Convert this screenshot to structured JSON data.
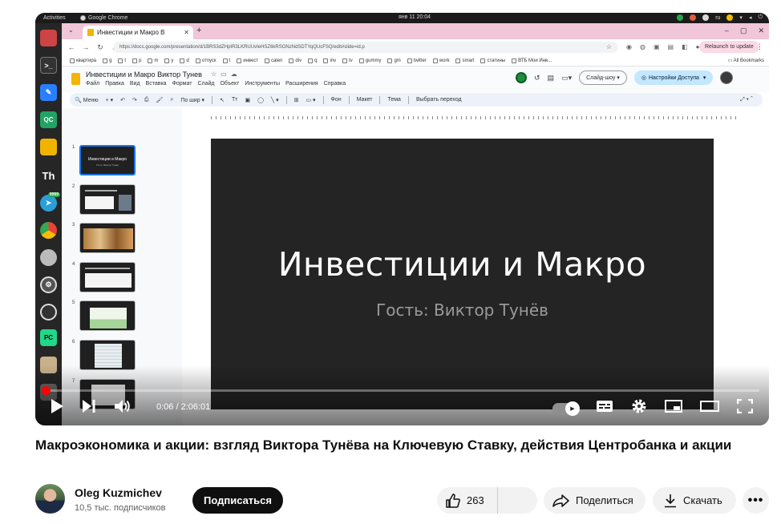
{
  "os_bar": {
    "activities": "Activities",
    "app_name": "Google Chrome",
    "clock": "янв 11  20:04",
    "lang": "ru"
  },
  "browser": {
    "tab_title": "Инвестиции и Макро В",
    "url": "https://docs.google.com/presentation/d/1BRS3dZHpIR3LKRUUvIeHSZ6kRSONzNdSDTYqQUcFSQ/edit#slide=id.p",
    "relaunch": "Relaunch to update",
    "all_bookmarks": "All Bookmarks",
    "bookmarks": [
      "квартира",
      "g",
      "t",
      "p",
      "m",
      "y",
      "d",
      "отпуск",
      "t",
      "инвест",
      "calen",
      "div",
      "q",
      "inv",
      "tv",
      "gummy",
      "gm",
      "twitter",
      "work",
      "smart",
      "статины",
      "ВТБ Мои Инв...",
      ""
    ]
  },
  "slides": {
    "doc_title": "Инвестиции и Макро Виктор Тунев",
    "menu": [
      "Файл",
      "Правка",
      "Вид",
      "Вставка",
      "Формат",
      "Слайд",
      "Объект",
      "Инструменты",
      "Расширения",
      "Справка"
    ],
    "slideshow_label": "Слайд-шоу",
    "share_label": "Настройки Доступа",
    "toolbar": {
      "menu_search": "Меню",
      "zoom": "По шир",
      "background": "Фон",
      "layout": "Макет",
      "theme": "Тема",
      "transition": "Выбрать переход"
    },
    "thumbnails": [
      {
        "num": "1",
        "title": "Инвестиции и Макро",
        "sub": "Гость: Виктор Тунёв"
      },
      {
        "num": "2"
      },
      {
        "num": "3"
      },
      {
        "num": "4"
      },
      {
        "num": "5"
      },
      {
        "num": "6"
      },
      {
        "num": "7"
      }
    ],
    "slide_title": "Инвестиции и Макро",
    "slide_subtitle": "Гость: Виктор Тунёв"
  },
  "player": {
    "time": "0:06 / 2:06:01",
    "progress": 0.0008
  },
  "video": {
    "title": "Макроэкономика и акции: взгляд Виктора Тунёва на Ключевую Ставку, действия Центробанка и акции",
    "channel_name": "Oleg Kuzmichev",
    "subscribers": "10,5 тыс. подписчиков",
    "subscribe_label": "Подписаться",
    "likes": "263",
    "share_label": "Поделиться",
    "download_label": "Скачать",
    "more_label": "•••"
  },
  "colors": {
    "accent_red": "#ff0000",
    "slide_bg": "#242424",
    "share_blue": "#c2e7ff"
  }
}
